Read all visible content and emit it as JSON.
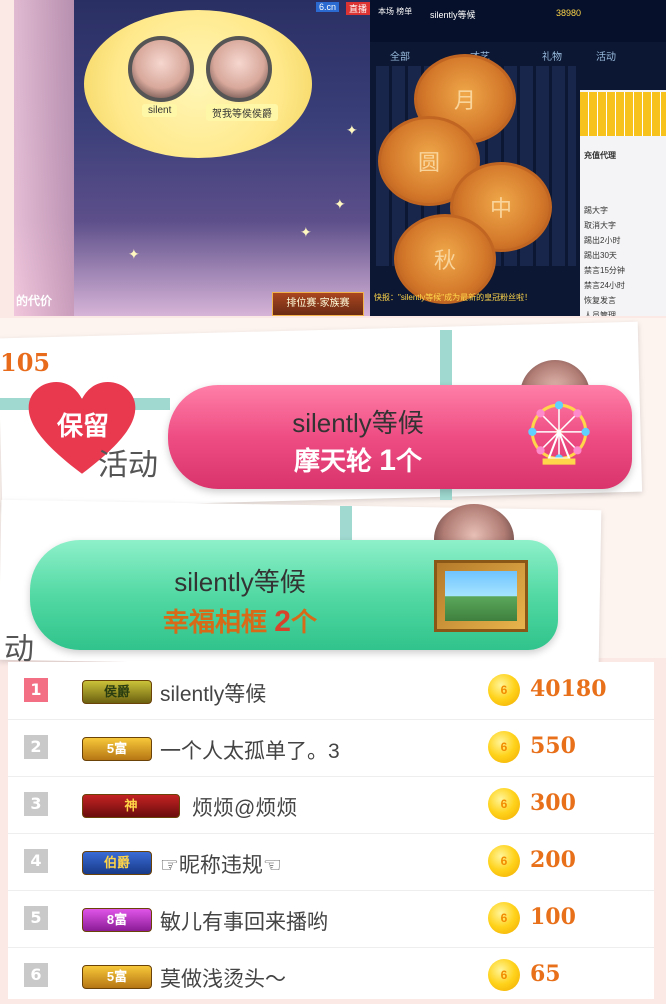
{
  "stream": {
    "site_logo": "6.cn",
    "live_tag": "直播",
    "guest_names": [
      "silent",
      "贺我等侯侯爵"
    ],
    "agent_text": "的代价",
    "rank_button": "排位赛·家族赛"
  },
  "chat": {
    "room_label": "本场\n榜单",
    "room_rank": "1",
    "top_user": "silently等候",
    "top_coins": "38980",
    "tabs": [
      "全部",
      "才艺",
      "礼物",
      "活动"
    ],
    "mooncake_chars": [
      "月",
      "圆",
      "中",
      "秋"
    ],
    "broadcast": "快报：\"silently等候\"成为最新的皇冠粉丝啦！",
    "panel_title": "充值代理",
    "panel_options": [
      "踢大字",
      "取消大字",
      "踢出2小时",
      "踢出30天",
      "禁言15分钟",
      "禁言24小时",
      "恢复发言",
      "人员管理"
    ]
  },
  "banners": {
    "score": "105",
    "reserve_label": "保留",
    "activity_label": "活动",
    "pink": {
      "user": "silently等候",
      "gift_name": "摩天轮",
      "count": "1",
      "unit": "个"
    },
    "green": {
      "user": "silently等候",
      "gift_name": "幸福相框",
      "count": "2",
      "unit": "个"
    }
  },
  "ranking": [
    {
      "rank": "1",
      "badge": "侯爵",
      "badge_style": "olive",
      "name": "silently等候",
      "amount": "40180"
    },
    {
      "rank": "2",
      "badge": "5富",
      "badge_style": "gold",
      "name": "一个人太孤单了。3",
      "amount": "550"
    },
    {
      "rank": "3",
      "badge": "神",
      "badge_style": "red",
      "name": "烦烦@烦烦",
      "amount": "300"
    },
    {
      "rank": "4",
      "badge": "伯爵",
      "badge_style": "blue",
      "name": "☞昵称违规☜",
      "amount": "200"
    },
    {
      "rank": "5",
      "badge": "8富",
      "badge_style": "purple",
      "name": "敏儿有事回来播哟",
      "amount": "100"
    },
    {
      "rank": "6",
      "badge": "5富",
      "badge_style": "gold",
      "name": "莫做浅烫头～",
      "amount": "65"
    }
  ],
  "coin_icon": "coin-icon",
  "colors": {
    "pink_banner": "#ee4d83",
    "green_banner": "#53d9a4",
    "amount": "#e8701a",
    "first_rank": "#f26f84"
  }
}
